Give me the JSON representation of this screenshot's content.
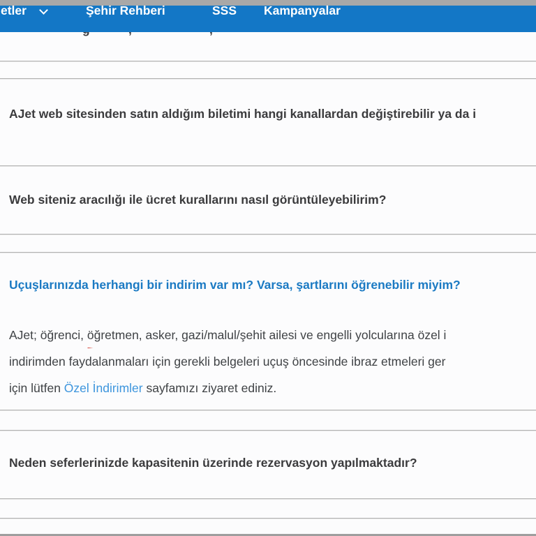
{
  "navbar": {
    "background_color": "#1377c6",
    "items": [
      {
        "label": "etler",
        "clipped": true,
        "has_chevron": true
      },
      {
        "label": "Şehir Rehberi"
      },
      {
        "label": "SSS"
      },
      {
        "label": "Kampanyalar"
      }
    ]
  },
  "clipped_line_fragments": [
    "ğ",
    ",",
    ","
  ],
  "faq": {
    "items": [
      {
        "question": "AJet web sitesinden satın aldığım biletimi hangi kanallardan değiştirebilir ya da i"
      },
      {
        "question": "Web siteniz aracılığı ile ücret kurallarını nasıl görüntüleyebilirim?"
      },
      {
        "question": "Uçuşlarınızda herhangi bir indirim var mı? Varsa, şartlarını öğrenebilir miyim?",
        "expanded": true,
        "answer": {
          "line1_prefix": "AJet; öğrenci, ",
          "line1_underlined": "öğretmen,",
          "line1_suffix": " asker, gazi/malul/şehit ailesi ve engelli yolcularına özel i",
          "line2": "indirimden faydalanmaları için gerekli belgeleri uçuş öncesinde ibraz etmeleri ger",
          "line3_prefix": "için lütfen ",
          "line3_link": "Özel İndirimler",
          "line3_suffix": " sayfamızı ziyaret ediniz."
        }
      },
      {
        "question": "Neden seferlerinizde kapasitenin üzerinde rezervasyon yapılmaktadır?"
      }
    ]
  },
  "colors": {
    "navbar_blue": "#1377c6",
    "active_question_blue": "#1b7ac3",
    "link_blue": "#3d95dd",
    "annotation_red": "#d43b30",
    "divider_gray": "#b2b2b2",
    "question_text": "#3b3b3d",
    "answer_text": "#3f4245"
  }
}
